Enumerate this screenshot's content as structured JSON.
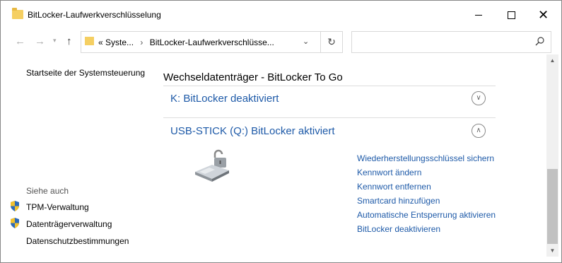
{
  "window": {
    "title": "BitLocker-Laufwerkverschlüsselung",
    "icon": "folder-icon",
    "controls": [
      "minimize-icon",
      "maximize-icon",
      "close-icon"
    ]
  },
  "address_bar": {
    "overflow": "«",
    "crumbs": [
      "Syste...",
      "BitLocker-Laufwerkverschlüsse..."
    ],
    "separator": "›",
    "search_placeholder": ""
  },
  "left_pane": {
    "home_link": "Startseite der Systemsteuerung",
    "see_also_heading": "Siehe auch",
    "see_also": [
      {
        "label": "TPM-Verwaltung",
        "icon": "shield-icon"
      },
      {
        "label": "Datenträgerverwaltung",
        "icon": "shield-icon"
      },
      {
        "label": "Datenschutzbestimmungen",
        "icon": ""
      }
    ]
  },
  "main": {
    "section_title": "Wechseldatenträger - BitLocker To Go",
    "drives": [
      {
        "title": "K: BitLocker deaktiviert",
        "expanded": false
      },
      {
        "title": "USB-STICK (Q:) BitLocker aktiviert",
        "expanded": true
      }
    ],
    "actions": [
      "Wiederherstellungsschlüssel sichern",
      "Kennwort ändern",
      "Kennwort entfernen",
      "Smartcard hinzufügen",
      "Automatische Entsperrung aktivieren",
      "BitLocker deaktivieren"
    ]
  },
  "colors": {
    "link": "#1e5aa8",
    "folder": "#f5cf62",
    "shield_blue": "#2d6ab7",
    "shield_yellow": "#f2c12e"
  }
}
